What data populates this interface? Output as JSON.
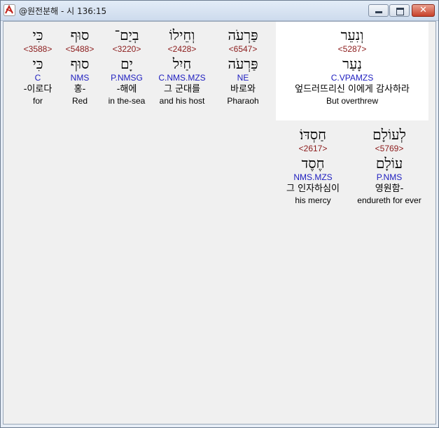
{
  "window": {
    "title": "@원전분해 - 시 136:15",
    "close_glyph": "✕"
  },
  "words": [
    {
      "heb": "כִּי",
      "strong": "<3588>",
      "lexeme": "כִּי",
      "morph": "C",
      "korean": "-이로다",
      "english": "for"
    },
    {
      "heb": "סוּף",
      "strong": "<5488>",
      "lexeme": "סוּף",
      "morph": "NMS",
      "korean": "홍-",
      "english": "Red"
    },
    {
      "heb": "בְיַם־",
      "strong": "<3220>",
      "lexeme": "יָם",
      "morph": "P.NMSG",
      "korean": "-해에",
      "english": "in the-sea"
    },
    {
      "heb": "וְחֵילוֹ",
      "strong": "<2428>",
      "lexeme": "חַיִל",
      "morph": "C.NMS.MZS",
      "korean": "그 군대를",
      "english": "and his host"
    },
    {
      "heb": "פַּרְעֹה",
      "strong": "<6547>",
      "lexeme": "פַּרְעֹה",
      "morph": "NE",
      "korean": "바로와",
      "english": "Pharaoh"
    },
    {
      "heb": "וְנִעֵר",
      "strong": "<5287>",
      "lexeme": "נָעַר",
      "morph": "C.VPAMZS",
      "korean": "엎드러뜨리신 이에게 감사하라",
      "english": "But overthrew"
    },
    {
      "heb": "חַסְדּוֹ׃",
      "strong": "<2617>",
      "lexeme": "חֶסֶד",
      "morph": "NMS.MZS",
      "korean": "그 인자하심이",
      "english": "his mercy"
    },
    {
      "heb": "לְעוֹלָם",
      "strong": "<5769>",
      "lexeme": "עוֹלָם",
      "morph": "P.NMS",
      "korean": "영원함-",
      "english": "endureth for ever"
    }
  ]
}
